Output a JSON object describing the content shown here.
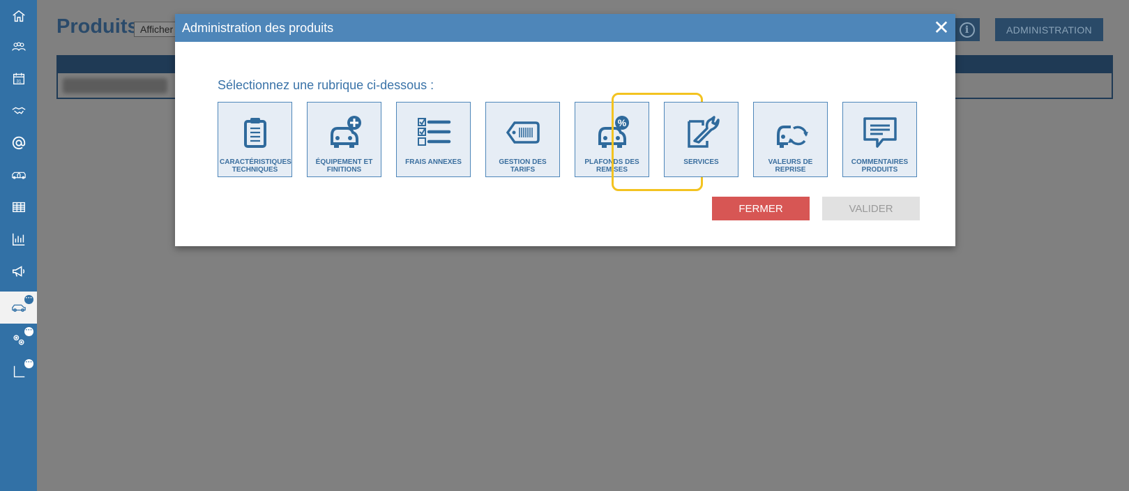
{
  "sidebar": {
    "items": [
      {
        "icon": "home-icon"
      },
      {
        "icon": "users-group-icon"
      },
      {
        "icon": "calendar-icon",
        "text": "31"
      },
      {
        "icon": "handshake-icon"
      },
      {
        "icon": "at-sign-icon"
      },
      {
        "icon": "vehicles-icon"
      },
      {
        "icon": "table-icon"
      },
      {
        "icon": "bar-chart-icon"
      },
      {
        "icon": "megaphone-icon"
      },
      {
        "icon": "car-icon",
        "badge": "···",
        "active": true
      },
      {
        "icon": "gears-icon",
        "badge": "···"
      },
      {
        "icon": "axis-chart-icon",
        "badge": "···"
      }
    ]
  },
  "page": {
    "title": "Produits",
    "select_value": "Afficher",
    "admin_button": "ADMINISTRATION",
    "info_glyph": "i"
  },
  "modal": {
    "title": "Administration des produits",
    "close_glyph": "✕",
    "prompt": "Sélectionnez une rubrique ci-dessous :",
    "tiles": [
      {
        "label": "CARACTÉRISTIQUES TECHNIQUES",
        "icon": "clipboard-icon"
      },
      {
        "label": "ÉQUIPEMENT ET FINITIONS",
        "icon": "car-plus-icon"
      },
      {
        "label": "FRAIS ANNEXES",
        "icon": "checklist-icon"
      },
      {
        "label": "GESTION DES TARIFS",
        "icon": "price-tag-icon"
      },
      {
        "label": "PLAFONDS DES REMISES",
        "icon": "car-percent-icon",
        "highlighted": true
      },
      {
        "label": "SERVICES",
        "icon": "wrench-icon"
      },
      {
        "label": "VALEURS DE REPRISE",
        "icon": "car-cycle-icon"
      },
      {
        "label": "COMMENTAIRES PRODUITS",
        "icon": "comment-icon"
      }
    ],
    "close_button": "FERMER",
    "validate_button": "VALIDER"
  },
  "colors": {
    "sidebar": "#3271a6",
    "modal_header": "#4e86b9",
    "tile_bg": "#e6edf5",
    "icon": "#2f6a9c",
    "highlight": "#f3c320",
    "close_button": "#d75654",
    "disabled_button": "#e1e1e1",
    "overlay": "#808080"
  }
}
